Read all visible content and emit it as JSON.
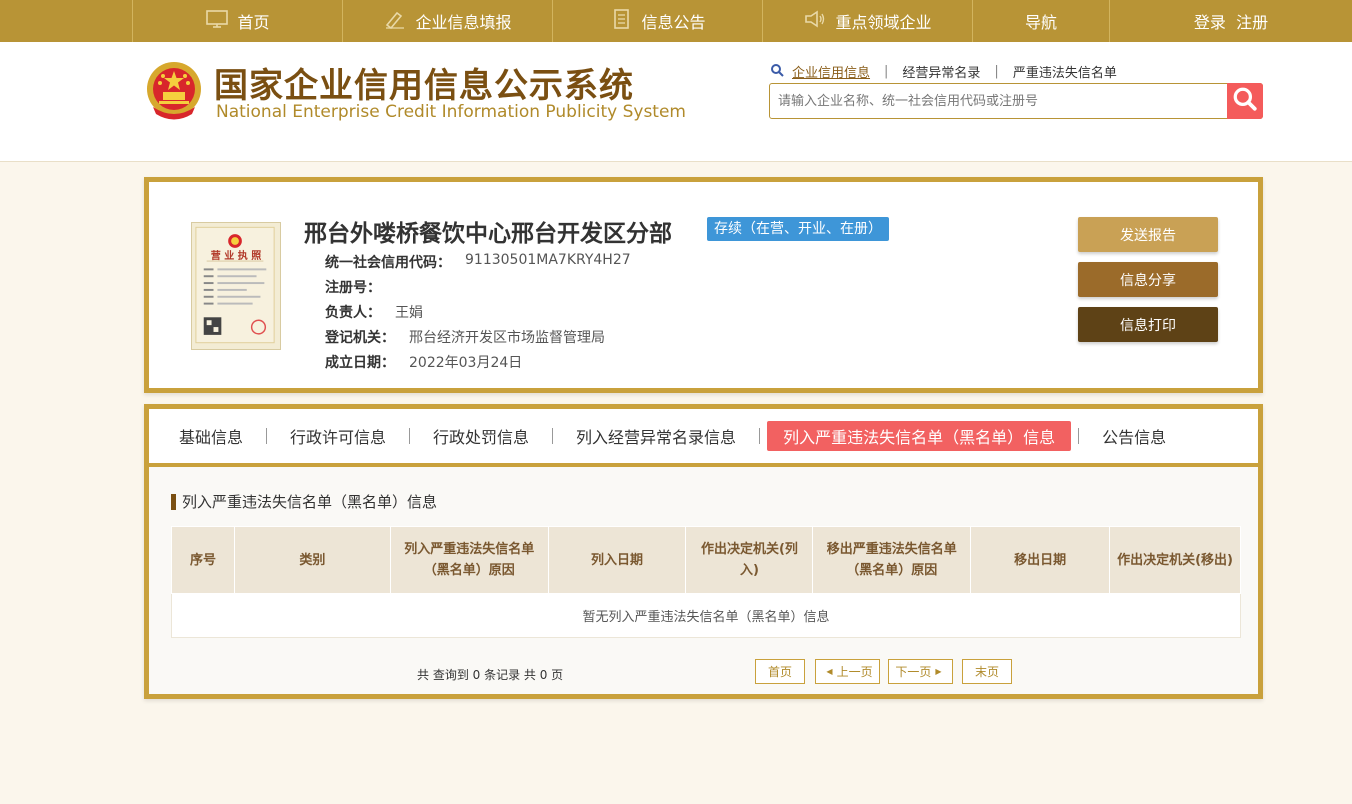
{
  "nav": {
    "items": [
      {
        "label": "首页",
        "icon": "monitor-icon"
      },
      {
        "label": "企业信息填报",
        "icon": "pen-icon"
      },
      {
        "label": "信息公告",
        "icon": "document-icon"
      },
      {
        "label": "重点领域企业",
        "icon": "speaker-icon"
      },
      {
        "label": "导航"
      },
      {
        "label": "登录  注册"
      }
    ]
  },
  "header": {
    "title_cn": "国家企业信用信息公示系统",
    "title_en": "National Enterprise Credit Information Publicity System",
    "quick_links": [
      "企业信用信息",
      "经营异常名录",
      "严重违法失信名单"
    ],
    "search_placeholder": "请输入企业名称、统一社会信用代码或注册号"
  },
  "company": {
    "name": "邢台外喽桥餐饮中心邢台开发区分部",
    "status": "存续（在营、开业、在册）",
    "fields": [
      {
        "label": "统一社会信用代码：",
        "value": "91130501MA7KRY4H27"
      },
      {
        "label": "注册号：",
        "value": ""
      },
      {
        "label": "负责人：",
        "value": "王娟"
      },
      {
        "label": "登记机关：",
        "value": "邢台经济开发区市场监督管理局"
      },
      {
        "label": "成立日期：",
        "value": "2022年03月24日"
      }
    ],
    "license_title": "营 业 执 照",
    "actions": {
      "report": "发送报告",
      "share": "信息分享",
      "print": "信息打印"
    }
  },
  "details": {
    "tabs": [
      "基础信息",
      "行政许可信息",
      "行政处罚信息",
      "列入经营异常名录信息",
      "列入严重违法失信名单（黑名单）信息",
      "公告信息"
    ],
    "active_tab": 4,
    "section_title": "列入严重违法失信名单（黑名单）信息",
    "columns": [
      "序号",
      "类别",
      "列入严重违法失信名单（黑名单）原因",
      "列入日期",
      "作出决定机关(列入)",
      "移出严重违法失信名单（黑名单）原因",
      "移出日期",
      "作出决定机关(移出)"
    ],
    "empty_text": "暂无列入严重违法失信名单（黑名单）信息",
    "pager": {
      "info": "共 查询到 0 条记录 共 0 页",
      "first": "首页",
      "prev": "上一页",
      "next": "下一页",
      "last": "末页"
    }
  },
  "colors": {
    "gold": "#b89436",
    "border_gold": "#c9a13c",
    "active_tab": "#f26161",
    "status_blue": "#3e96d8",
    "search_red": "#f45b5b"
  }
}
